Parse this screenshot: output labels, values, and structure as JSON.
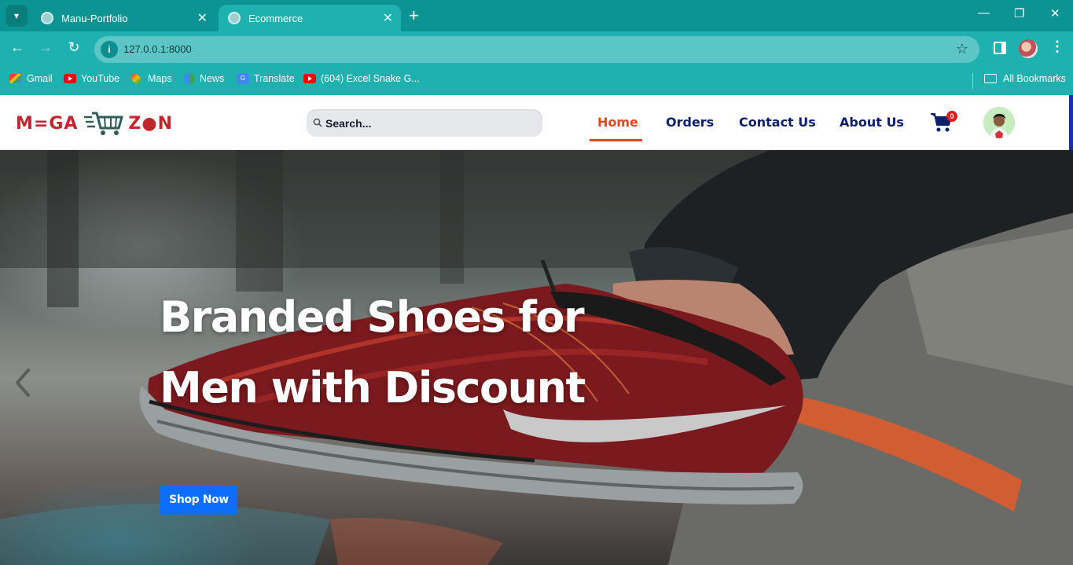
{
  "browser": {
    "tabs": [
      {
        "title": "Manu-Portfolio",
        "active": false
      },
      {
        "title": "Ecommerce",
        "active": true
      }
    ],
    "url": "127.0.0.1:8000",
    "bookmarks": [
      {
        "label": "Gmail",
        "icon": "gmail-icon"
      },
      {
        "label": "YouTube",
        "icon": "youtube-icon"
      },
      {
        "label": "Maps",
        "icon": "maps-icon"
      },
      {
        "label": "News",
        "icon": "news-icon"
      },
      {
        "label": "Translate",
        "icon": "translate-icon"
      },
      {
        "label": "(604) Excel Snake G...",
        "icon": "youtube-icon"
      }
    ],
    "all_bookmarks_label": "All Bookmarks",
    "colors": {
      "frame": "#0c9494",
      "toolbar": "#1fb0b0"
    }
  },
  "site": {
    "logo": {
      "left": "M=GA",
      "right": "Z●N"
    },
    "search": {
      "placeholder": "Search..."
    },
    "nav": [
      {
        "label": "Home",
        "active": true
      },
      {
        "label": "Orders",
        "active": false
      },
      {
        "label": "Contact Us",
        "active": false
      },
      {
        "label": "About Us",
        "active": false
      }
    ],
    "cart_count": "0",
    "colors": {
      "accent": "#e8471d",
      "nav": "#0b1f6b",
      "button": "#0d6efd",
      "badge": "#e31b1b",
      "logo": "#c0272d"
    }
  },
  "hero": {
    "title_line1": "Branded Shoes for",
    "title_line2": "Men with Discount",
    "cta_label": "Shop Now"
  }
}
